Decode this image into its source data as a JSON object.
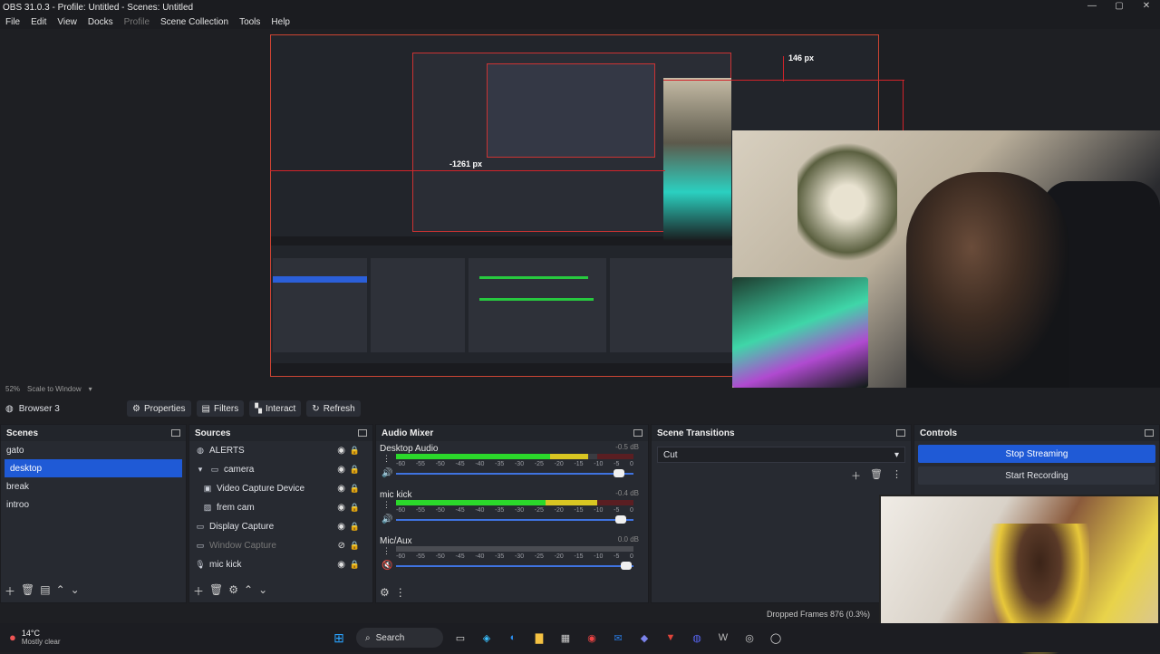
{
  "window": {
    "title": "OBS 31.0.3 - Profile: Untitled - Scenes: Untitled",
    "min": "—",
    "max": "▢",
    "close": "✕"
  },
  "menu": [
    "File",
    "Edit",
    "View",
    "Docks",
    "Profile",
    "Scene Collection",
    "Tools",
    "Help"
  ],
  "preview": {
    "zoom": "52%",
    "scale_mode": "Scale to Window",
    "measure_top": "146 px",
    "measure_left": "-1261 px"
  },
  "toolbar": {
    "source_name": "Browser 3",
    "properties": "Properties",
    "filters": "Filters",
    "interact": "Interact",
    "refresh": "Refresh"
  },
  "scenes": {
    "title": "Scenes",
    "items": [
      "gato",
      "desktop",
      "break",
      "introo"
    ],
    "selected": 1
  },
  "sources": {
    "title": "Sources",
    "items": [
      {
        "label": "ALERTS",
        "icon": "globe",
        "indent": 0
      },
      {
        "label": "camera",
        "icon": "folder",
        "indent": 1
      },
      {
        "label": "Video Capture Device",
        "icon": "camera",
        "indent": 2
      },
      {
        "label": "frem cam",
        "icon": "image",
        "indent": 2
      },
      {
        "label": "Display Capture",
        "icon": "monitor",
        "indent": 0
      },
      {
        "label": "Window Capture",
        "icon": "window",
        "indent": 0
      },
      {
        "label": "mic kick",
        "icon": "mic",
        "indent": 0
      }
    ]
  },
  "mixer": {
    "title": "Audio Mixer",
    "channels": [
      {
        "name": "Desktop Audio",
        "db": "-0.5 dB",
        "level": 0.62
      },
      {
        "name": "mic kick",
        "db": "-0.4 dB",
        "level": 0.85
      },
      {
        "name": "Mic/Aux",
        "db": "0.0 dB",
        "level": 0.0
      }
    ],
    "scale": [
      "-60",
      "-55",
      "-50",
      "-45",
      "-40",
      "-35",
      "-30",
      "-25",
      "-20",
      "-15",
      "-10",
      "-5",
      "0"
    ]
  },
  "transitions": {
    "title": "Scene Transitions",
    "selected": "Cut"
  },
  "controls": {
    "title": "Controls",
    "stop_streaming": "Stop Streaming",
    "start_recording": "Start Recording"
  },
  "status": {
    "dropped": "Dropped Frames 876 (0.3%)"
  },
  "taskbar": {
    "temp": "14°C",
    "condition": "Mostly clear",
    "search": "Search"
  },
  "colors": {
    "accent": "#1f5ad6",
    "meter_green": "#2bd82b",
    "meter_yellow": "#d9c622",
    "meter_red": "#b8232a",
    "guide_red": "#d2232a"
  }
}
